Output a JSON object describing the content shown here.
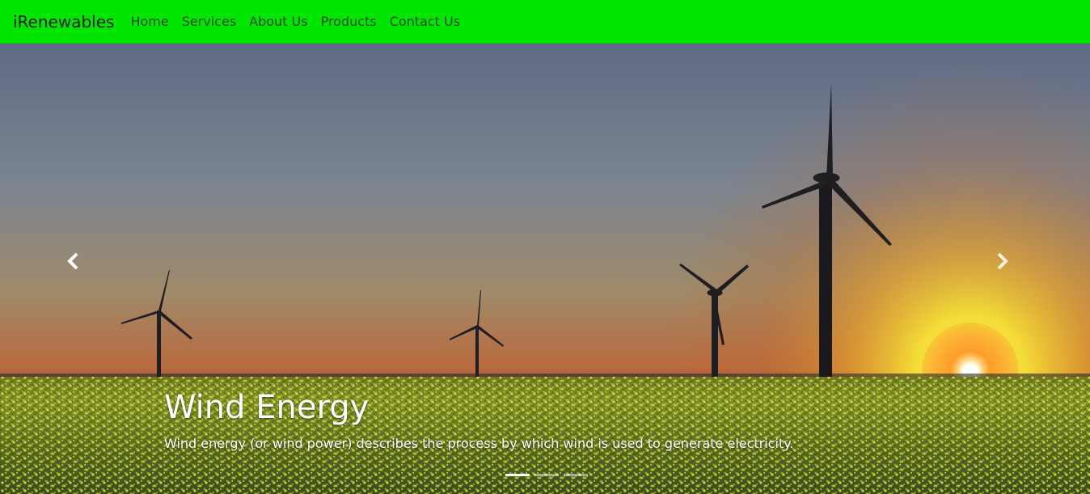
{
  "navbar": {
    "brand": "iRenewables",
    "items": [
      {
        "label": "Home"
      },
      {
        "label": "Services"
      },
      {
        "label": "About Us"
      },
      {
        "label": "Products"
      },
      {
        "label": "Contact Us"
      }
    ],
    "background_color": "#00e600"
  },
  "carousel": {
    "slides_count": 3,
    "active_index": 0,
    "caption": {
      "title": "Wind Energy",
      "text": "Wind energy (or wind power) describes the process by which wind is used to generate electricity."
    },
    "controls": {
      "prev_icon": "chevron-left-icon",
      "next_icon": "chevron-right-icon"
    }
  }
}
